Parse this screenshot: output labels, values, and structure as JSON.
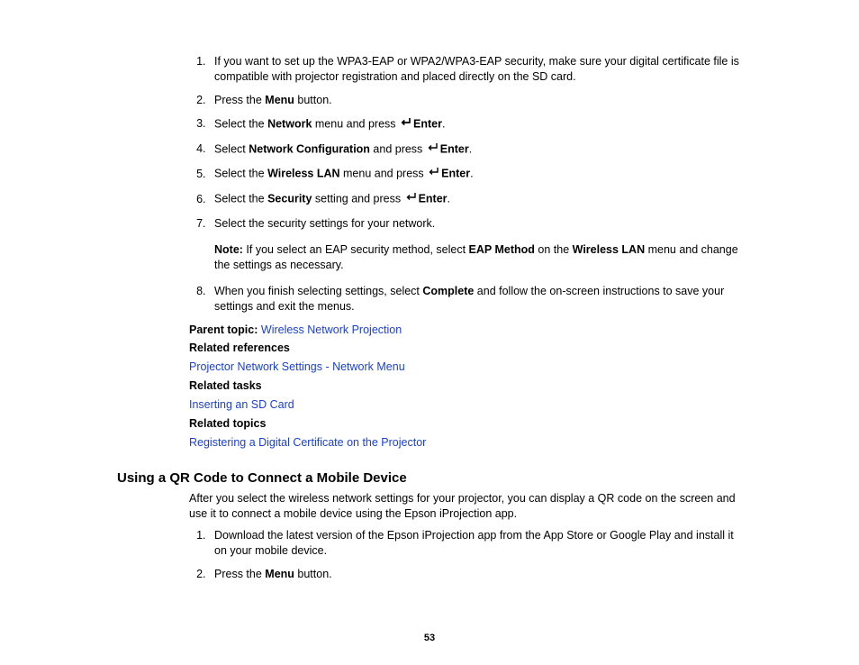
{
  "steps_a": {
    "s1": "If you want to set up the WPA3-EAP or WPA2/WPA3-EAP security, make sure your digital certificate file is compatible with projector registration and placed directly on the SD card.",
    "s2a": "Press the ",
    "s2b": "Menu",
    "s2c": " button.",
    "s3a": "Select the ",
    "s3b": "Network",
    "s3c": " menu and press ",
    "s3d": "Enter",
    "s3e": ".",
    "s4a": "Select ",
    "s4b": "Network Configuration",
    "s4c": " and press ",
    "s4d": "Enter",
    "s4e": ".",
    "s5a": "Select the ",
    "s5b": "Wireless LAN",
    "s5c": " menu and press ",
    "s5d": "Enter",
    "s5e": ".",
    "s6a": "Select the ",
    "s6b": "Security",
    "s6c": " setting and press ",
    "s6d": "Enter",
    "s6e": ".",
    "s7": "Select the security settings for your network.",
    "note_label": "Note:",
    "note_a": " If you select an EAP security method, select ",
    "note_b": "EAP Method",
    "note_c": " on the ",
    "note_d": "Wireless LAN",
    "note_e": " menu and change the settings as necessary.",
    "s8a": "When you finish selecting settings, select ",
    "s8b": "Complete",
    "s8c": " and follow the on-screen instructions to save your settings and exit the menus."
  },
  "refs": {
    "parent_label": "Parent topic:",
    "parent_link": "Wireless Network Projection",
    "related_refs_label": "Related references",
    "related_refs_link": "Projector Network Settings - Network Menu",
    "related_tasks_label": "Related tasks",
    "related_tasks_link": "Inserting an SD Card",
    "related_topics_label": "Related topics",
    "related_topics_link": "Registering a Digital Certificate on the Projector"
  },
  "section2": {
    "heading": "Using a QR Code to Connect a Mobile Device",
    "intro": "After you select the wireless network settings for your projector, you can display a QR code on the screen and use it to connect a mobile device using the Epson iProjection app.",
    "s1": "Download the latest version of the Epson iProjection app from the App Store or Google Play and install it on your mobile device.",
    "s2a": "Press the ",
    "s2b": "Menu",
    "s2c": " button."
  },
  "page_number": "53"
}
